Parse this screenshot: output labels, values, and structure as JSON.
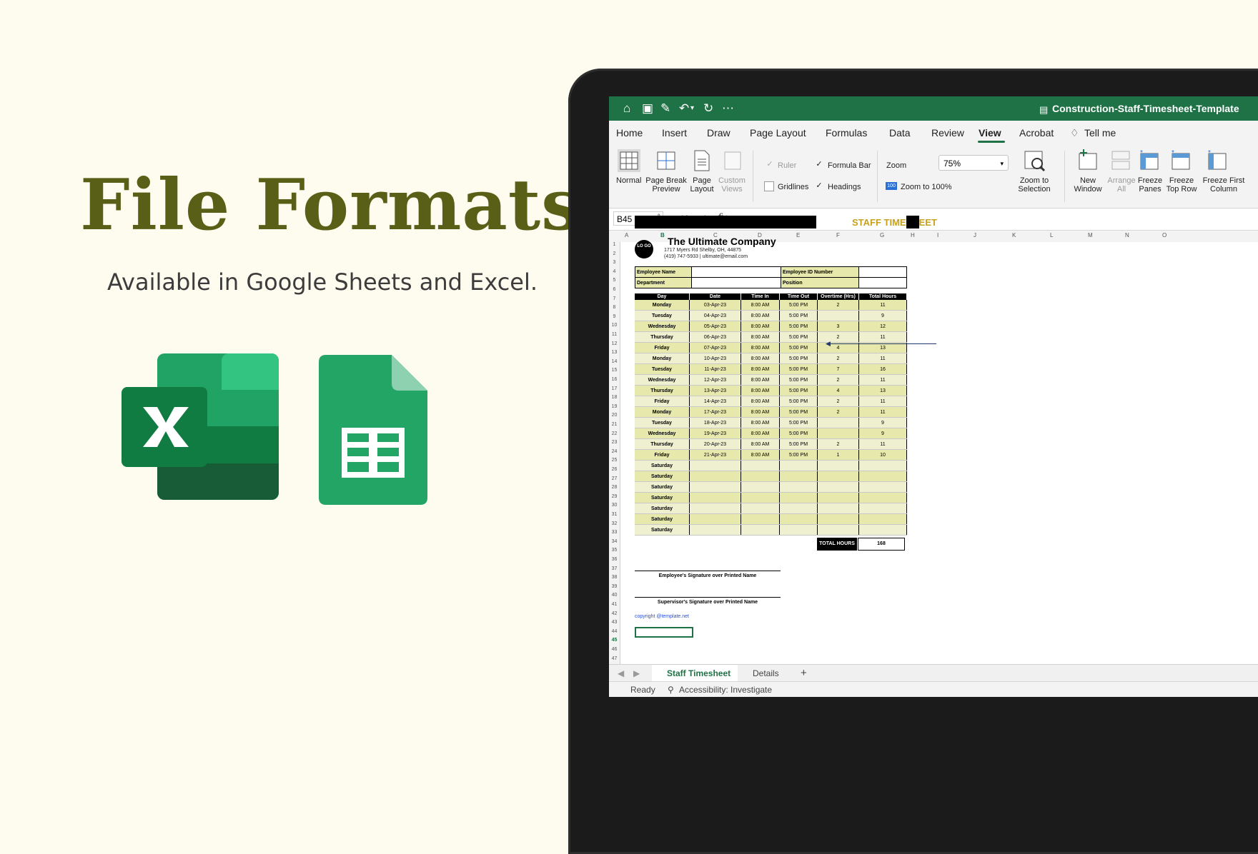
{
  "hero": {
    "title": "File Formats",
    "subtitle": "Available in Google Sheets and Excel."
  },
  "icons": {
    "excel": "excel-logo-icon",
    "sheets": "google-sheets-logo-icon"
  },
  "app": {
    "window_title": "Construction-Staff-Timesheet-Template",
    "menu": [
      "Home",
      "Insert",
      "Draw",
      "Page Layout",
      "Formulas",
      "Data",
      "Review",
      "View",
      "Acrobat",
      "Tell me"
    ],
    "active_menu": "View",
    "ribbon": {
      "normal": "Normal",
      "page_break_1": "Page Break",
      "page_break_2": "Preview",
      "page_layout_1": "Page",
      "page_layout_2": "Layout",
      "custom_views_1": "Custom",
      "custom_views_2": "Views",
      "ruler": "Ruler",
      "formula_bar": "Formula Bar",
      "gridlines": "Gridlines",
      "headings": "Headings",
      "zoom_label": "Zoom",
      "zoom_value": "75%",
      "zoom_100": "Zoom to 100%",
      "zoom_sel_1": "Zoom to",
      "zoom_sel_2": "Selection",
      "new_window_1": "New",
      "new_window_2": "Window",
      "arrange_1": "Arrange",
      "arrange_2": "All",
      "freeze_panes_1": "Freeze",
      "freeze_panes_2": "Panes",
      "freeze_top_1": "Freeze",
      "freeze_top_2": "Top Row",
      "freeze_col_1": "Freeze First",
      "freeze_col_2": "Column"
    },
    "name_box": "B45",
    "fx": "fx",
    "columns": [
      "A",
      "B",
      "C",
      "D",
      "E",
      "F",
      "G",
      "H",
      "I",
      "J",
      "K",
      "L",
      "M",
      "N",
      "O"
    ],
    "sheet_tabs": [
      "Staff Timesheet",
      "Details"
    ],
    "active_sheet": "Staff Timesheet",
    "status": {
      "ready": "Ready",
      "accessibility": "Accessibility: Investigate"
    }
  },
  "timesheet": {
    "title": "STAFF TIMESHEET",
    "logo_text": "LO GO",
    "company": "The Ultimate Company",
    "address": "1717 Myers Rd Shelby, OH, 44875",
    "contact": "(419) 747-5933 | ultimate@email.com",
    "info_labels": {
      "employee_name": "Employee Name",
      "employee_id": "Employee ID Number",
      "department": "Department",
      "position": "Position"
    },
    "headers": [
      "Day",
      "Date",
      "Time In",
      "Time Out",
      "Overtime (Hrs)",
      "Total Hours"
    ],
    "rows": [
      [
        "Monday",
        "03-Apr-23",
        "8:00 AM",
        "5:00 PM",
        "2",
        "11"
      ],
      [
        "Tuesday",
        "04-Apr-23",
        "8:00 AM",
        "5:00 PM",
        "",
        "9"
      ],
      [
        "Wednesday",
        "05-Apr-23",
        "8:00 AM",
        "5:00 PM",
        "3",
        "12"
      ],
      [
        "Thursday",
        "06-Apr-23",
        "8:00 AM",
        "5:00 PM",
        "2",
        "11"
      ],
      [
        "Friday",
        "07-Apr-23",
        "8:00 AM",
        "5:00 PM",
        "4",
        "13"
      ],
      [
        "Monday",
        "10-Apr-23",
        "8:00 AM",
        "5:00 PM",
        "2",
        "11"
      ],
      [
        "Tuesday",
        "11-Apr-23",
        "8:00 AM",
        "5:00 PM",
        "7",
        "16"
      ],
      [
        "Wednesday",
        "12-Apr-23",
        "8:00 AM",
        "5:00 PM",
        "2",
        "11"
      ],
      [
        "Thursday",
        "13-Apr-23",
        "8:00 AM",
        "5:00 PM",
        "4",
        "13"
      ],
      [
        "Friday",
        "14-Apr-23",
        "8:00 AM",
        "5:00 PM",
        "2",
        "11"
      ],
      [
        "Monday",
        "17-Apr-23",
        "8:00 AM",
        "5:00 PM",
        "2",
        "11"
      ],
      [
        "Tuesday",
        "18-Apr-23",
        "8:00 AM",
        "5:00 PM",
        "",
        "9"
      ],
      [
        "Wednesday",
        "19-Apr-23",
        "8:00 AM",
        "5:00 PM",
        "",
        "9"
      ],
      [
        "Thursday",
        "20-Apr-23",
        "8:00 AM",
        "5:00 PM",
        "2",
        "11"
      ],
      [
        "Friday",
        "21-Apr-23",
        "8:00 AM",
        "5:00 PM",
        "1",
        "10"
      ],
      [
        "Saturday",
        "",
        "",
        "",
        "",
        ""
      ],
      [
        "Saturday",
        "",
        "",
        "",
        "",
        ""
      ],
      [
        "Saturday",
        "",
        "",
        "",
        "",
        ""
      ],
      [
        "Saturday",
        "",
        "",
        "",
        "",
        ""
      ],
      [
        "Saturday",
        "",
        "",
        "",
        "",
        ""
      ],
      [
        "Saturday",
        "",
        "",
        "",
        "",
        ""
      ],
      [
        "Saturday",
        "",
        "",
        "",
        "",
        ""
      ]
    ],
    "total_label": "TOTAL HOURS",
    "total_value": "168",
    "employee_signature": "Employee's Signature over Printed Name",
    "supervisor_signature": "Supervisor's Signature over Printed Name",
    "copyright": "copyright @template.net"
  },
  "colors": {
    "excel_green": "#1f7246",
    "title_olive": "#5a5f17",
    "row_yellow": "#e6e8ac",
    "timesheet_gold": "#c8a11b"
  }
}
